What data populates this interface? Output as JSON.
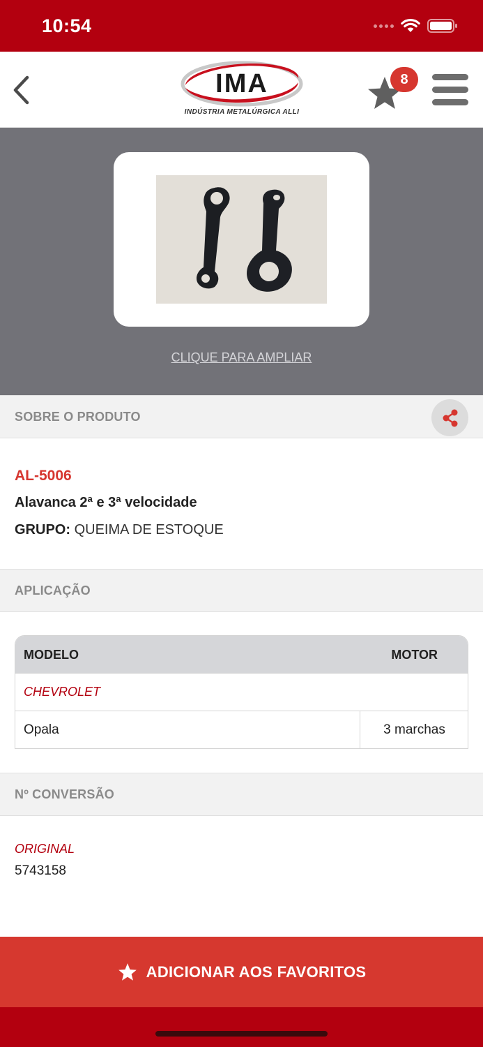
{
  "status_bar": {
    "time": "10:54"
  },
  "header": {
    "logo_text": "IMA",
    "logo_subtitle": "INDÚSTRIA METALÚRGICA ALLI",
    "favorites_count": "8",
    "back_icon": "chevron-left-icon",
    "menu_icon": "hamburger-menu-icon"
  },
  "product_image": {
    "zoom_label": "CLIQUE PARA AMPLIAR"
  },
  "about": {
    "section_title": "SOBRE O PRODUTO",
    "code": "AL-5006",
    "name": "Alavanca 2ª e 3ª velocidade",
    "group_label": "GRUPO:",
    "group_value": "QUEIMA DE ESTOQUE"
  },
  "application": {
    "section_title": "APLICAÇÃO",
    "columns": [
      "MODELO",
      "MOTOR"
    ],
    "brand": "CHEVROLET",
    "rows": [
      {
        "modelo": "Opala",
        "motor": "3 marchas"
      }
    ]
  },
  "conversion": {
    "section_title": "Nº CONVERSÃO",
    "label": "ORIGINAL",
    "value": "5743158"
  },
  "cta": {
    "label": "ADICIONAR AOS FAVORITOS"
  },
  "colors": {
    "brand_red": "#b3000f",
    "accent_red": "#d6362f",
    "image_bg": "#727278"
  }
}
